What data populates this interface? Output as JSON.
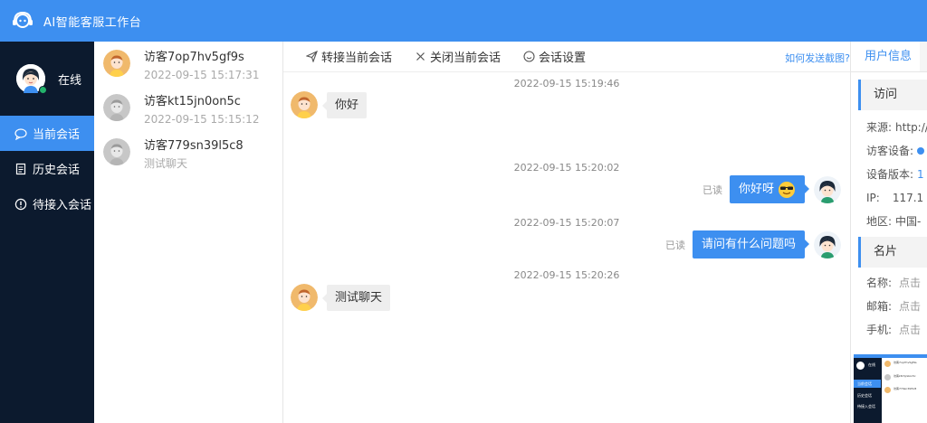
{
  "app": {
    "title": "AI智能客服工作台"
  },
  "agent": {
    "status": "在线"
  },
  "nav": {
    "items": [
      {
        "label": "当前会话",
        "icon": "chat-icon",
        "active": true
      },
      {
        "label": "历史会话",
        "icon": "document-icon",
        "active": false
      },
      {
        "label": "待接入会话",
        "icon": "info-icon",
        "active": false
      }
    ]
  },
  "visitors": [
    {
      "name": "访客7op7hv5gf9s",
      "sub": "2022-09-15 15:17:31",
      "avatar": "color"
    },
    {
      "name": "访客kt15jn0on5c",
      "sub": "2022-09-15 15:15:12",
      "avatar": "gray"
    },
    {
      "name": "访客779sn39l5c8",
      "sub": "测试聊天",
      "avatar": "gray"
    }
  ],
  "toolbar": {
    "transfer": "转接当前会话",
    "close": "关闭当前会话",
    "settings": "会话设置",
    "help": "如何发送截图?"
  },
  "messages": [
    {
      "time": "2022-09-15 15:19:46",
      "side": "left",
      "text": "你好"
    },
    {
      "time": "2022-09-15 15:20:02",
      "side": "right",
      "text": "你好呀",
      "read": "已读",
      "emoji": "cool-face"
    },
    {
      "time": "2022-09-15 15:20:07",
      "side": "right",
      "text": "请问有什么问题吗",
      "read": "已读"
    },
    {
      "time": "2022-09-15 15:20:26",
      "side": "left",
      "text": "测试聊天"
    }
  ],
  "right_panel": {
    "tab": "用户信息",
    "visit_title": "访问",
    "visit_rows": [
      {
        "label": "来源:",
        "value": "http://"
      },
      {
        "label": "访客设备:",
        "value": ""
      },
      {
        "label": "设备版本:",
        "value": "1"
      },
      {
        "label": "IP:",
        "value": "117.1"
      },
      {
        "label": "地区:",
        "value": "中国-"
      }
    ],
    "card_title": "名片",
    "card_rows": [
      {
        "label": "名称:",
        "value": "点击"
      },
      {
        "label": "邮箱:",
        "value": "点击"
      },
      {
        "label": "手机:",
        "value": "点击"
      }
    ]
  },
  "thumbnail": {
    "status": "在线",
    "nav": [
      "当前会话",
      "历史会话",
      "待接入会话"
    ],
    "visitors": [
      "访客7op7hv5gf9s",
      "访客kt15jn0on5c",
      "访客779sn39l5c8"
    ]
  }
}
